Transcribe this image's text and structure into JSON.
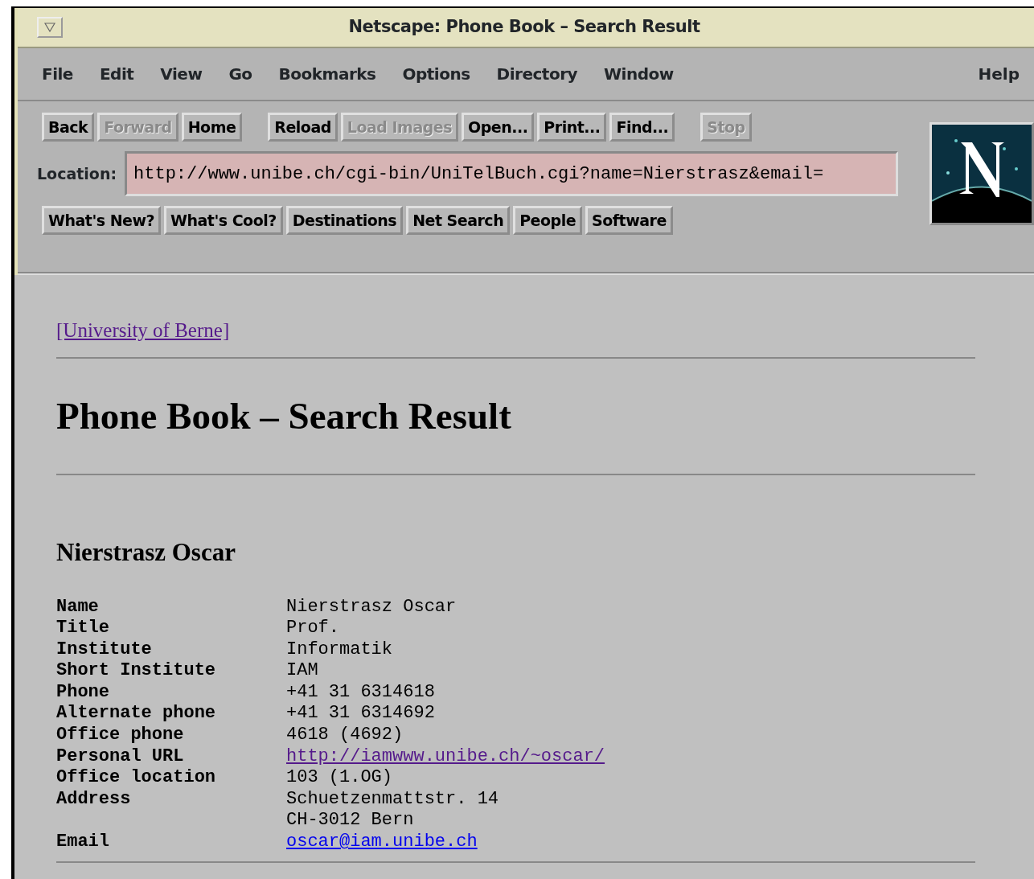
{
  "window": {
    "title": "Netscape: Phone Book – Search Result"
  },
  "menu": {
    "items": [
      {
        "label": "File"
      },
      {
        "label": "Edit"
      },
      {
        "label": "View"
      },
      {
        "label": "Go"
      },
      {
        "label": "Bookmarks"
      },
      {
        "label": "Options"
      },
      {
        "label": "Directory"
      },
      {
        "label": "Window"
      }
    ],
    "help": "Help"
  },
  "toolbar": {
    "groups": [
      [
        {
          "label": "Back",
          "disabled": false
        },
        {
          "label": "Forward",
          "disabled": true
        },
        {
          "label": "Home",
          "disabled": false
        }
      ],
      [
        {
          "label": "Reload",
          "disabled": false
        },
        {
          "label": "Load Images",
          "disabled": true
        },
        {
          "label": "Open...",
          "disabled": false
        },
        {
          "label": "Print...",
          "disabled": false
        },
        {
          "label": "Find...",
          "disabled": false
        }
      ],
      [
        {
          "label": "Stop",
          "disabled": true
        }
      ]
    ]
  },
  "location": {
    "label": "Location:",
    "value": "http://www.unibe.ch/cgi-bin/UniTelBuch.cgi?name=Nierstrasz&email="
  },
  "directory_buttons": [
    {
      "label": "What's New?"
    },
    {
      "label": "What's Cool?"
    },
    {
      "label": "Destinations"
    },
    {
      "label": "Net Search"
    },
    {
      "label": "People"
    },
    {
      "label": "Software"
    }
  ],
  "page": {
    "top_link": {
      "text": "[University of Berne]",
      "visited": true
    },
    "heading": "Phone Book – Search Result",
    "person": "Nierstrasz Oscar",
    "fields": [
      {
        "label": "Name",
        "lines": [
          "Nierstrasz Oscar"
        ]
      },
      {
        "label": "Title",
        "lines": [
          "Prof."
        ]
      },
      {
        "label": "Institute",
        "lines": [
          "Informatik"
        ]
      },
      {
        "label": "Short Institute",
        "lines": [
          "IAM"
        ]
      },
      {
        "label": "Phone",
        "lines": [
          "+41 31 6314618"
        ]
      },
      {
        "label": "Alternate phone",
        "lines": [
          "+41 31 6314692"
        ]
      },
      {
        "label": "Office phone",
        "lines": [
          "4618 (4692)"
        ]
      },
      {
        "label": "Personal URL",
        "link": {
          "text": "http://iamwww.unibe.ch/~oscar/",
          "visited": true
        }
      },
      {
        "label": "Office location",
        "lines": [
          "103 (1.OG)"
        ]
      },
      {
        "label": "Address",
        "lines": [
          "Schuetzenmattstr. 14",
          "CH-3012 Bern"
        ]
      },
      {
        "label": "Email",
        "link": {
          "text": "oscar@iam.unibe.ch",
          "visited": false
        }
      }
    ]
  }
}
